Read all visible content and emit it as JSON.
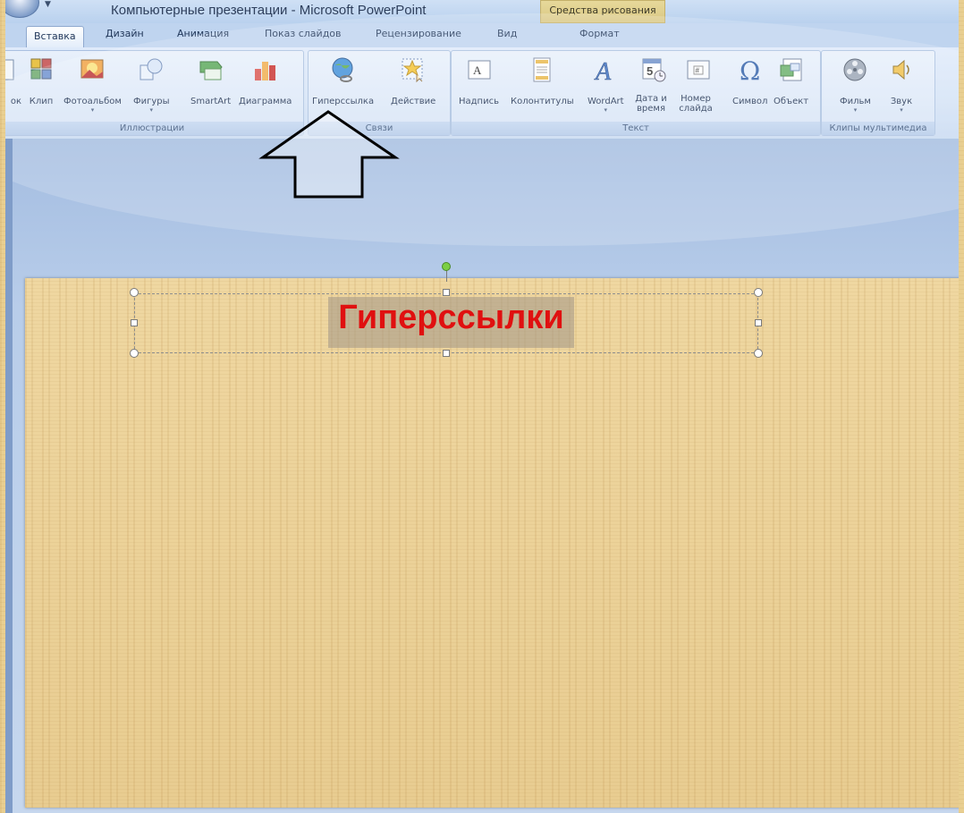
{
  "window": {
    "title": "Компьютерные презентации - Microsoft PowerPoint",
    "context_tab": "Средства рисования"
  },
  "tabs": [
    {
      "label": "Вставка",
      "active": true
    },
    {
      "label": "Дизайн"
    },
    {
      "label": "Анимация"
    },
    {
      "label": "Показ слайдов"
    },
    {
      "label": "Рецензирование"
    },
    {
      "label": "Вид"
    },
    {
      "label": "Формат"
    }
  ],
  "ribbon": {
    "groups": {
      "illustrations": {
        "label": "Иллюстрации",
        "buttons": [
          {
            "label": "ок",
            "icon": "picture-icon"
          },
          {
            "label": "Клип",
            "icon": "clipart-icon"
          },
          {
            "label": "Фотоальбом",
            "icon": "photo-album-icon"
          },
          {
            "label": "Фигуры",
            "icon": "shapes-icon"
          },
          {
            "label": "SmartArt",
            "icon": "smartart-icon"
          },
          {
            "label": "Диаграмма",
            "icon": "chart-icon"
          }
        ]
      },
      "links": {
        "label": "Связи",
        "buttons": [
          {
            "label": "Гиперссылка",
            "icon": "hyperlink-globe-icon"
          },
          {
            "label": "Действие",
            "icon": "action-star-icon"
          }
        ]
      },
      "text": {
        "label": "Текст",
        "buttons": [
          {
            "label": "Надпись",
            "icon": "textbox-icon"
          },
          {
            "label": "Колонтитулы",
            "icon": "header-footer-icon"
          },
          {
            "label": "WordArt",
            "icon": "wordart-icon"
          },
          {
            "label": "Дата и время",
            "icon": "date-time-icon"
          },
          {
            "label": "Номер слайда",
            "icon": "slide-number-icon"
          },
          {
            "label": "Символ",
            "icon": "omega-symbol-icon"
          },
          {
            "label": "Объект",
            "icon": "object-icon"
          }
        ]
      },
      "media": {
        "label": "Клипы мультимедиа",
        "buttons": [
          {
            "label": "Фильм",
            "icon": "film-reel-icon"
          },
          {
            "label": "Звук",
            "icon": "speaker-icon"
          }
        ]
      }
    }
  },
  "slide": {
    "title_text": "Гиперссылки",
    "title_color": "#e01010"
  },
  "colors": {
    "ribbon": "#d3e2f6",
    "workspace": "#b8cdea",
    "background": "#e9cf91"
  }
}
